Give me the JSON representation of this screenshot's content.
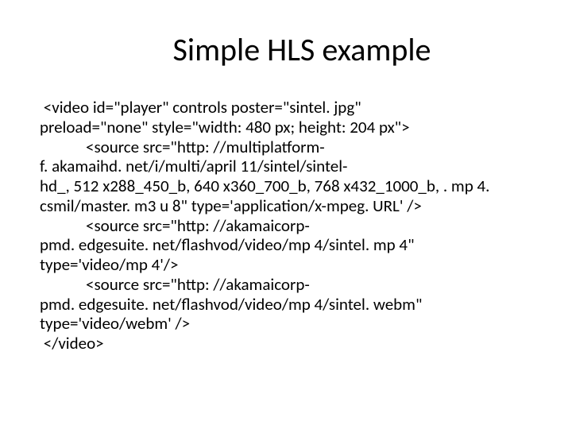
{
  "title": "Simple HLS example",
  "code": {
    "video_open_1": " <video id=\"player\" controls poster=\"sintel. jpg\"",
    "video_open_2": "preload=\"none\" style=\"width: 480 px; height: 204 px\">",
    "source1_a": "<source src=\"http: //multiplatform-",
    "source1_b": "f. akamaihd. net/i/multi/april 11/sintel/sintel-",
    "source1_c": "hd_, 512 x288_450_b, 640 x360_700_b, 768 x432_1000_b, . mp 4.",
    "source1_d": "csmil/master. m3 u 8\" type='application/x-mpeg. URL' />",
    "source2_a": "<source src=\"http: //akamaicorp-",
    "source2_b": "pmd. edgesuite. net/flashvod/video/mp 4/sintel. mp 4\"",
    "source2_c": "type='video/mp 4'/>",
    "source3_a": "<source src=\"http: //akamaicorp-",
    "source3_b": "pmd. edgesuite. net/flashvod/video/mp 4/sintel. webm\"",
    "source3_c": "type='video/webm' />",
    "video_close": " </video>"
  }
}
